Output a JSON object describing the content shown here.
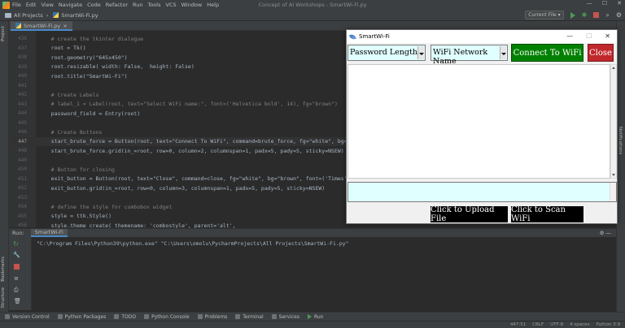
{
  "menubar": {
    "items": [
      "File",
      "Edit",
      "View",
      "Navigate",
      "Code",
      "Refactor",
      "Run",
      "Tools",
      "VCS",
      "Window",
      "Help"
    ],
    "window_title": "Concept of AI Workshops - SmartWi-Fi.py"
  },
  "navbar": {
    "breadcrumb_project": "All Projects",
    "breadcrumb_file": "SmartWi-Fi.py",
    "run_config": "Current File ▾"
  },
  "editor": {
    "tab_label": "SmartWi-Fi.py",
    "lines": [
      {
        "n": "436",
        "code": "    # create the tkinter dialogue"
      },
      {
        "n": "437",
        "code": "    root = Tk()"
      },
      {
        "n": "438",
        "code": "    root.geometry(\"645x450\")"
      },
      {
        "n": "439",
        "code": "    root.resizable( width: False,  height: False)"
      },
      {
        "n": "440",
        "code": "    root.title(\"SmartWi-Fi\")"
      },
      {
        "n": "441",
        "code": ""
      },
      {
        "n": "442",
        "code": "    # Create Labels"
      },
      {
        "n": "443",
        "code": "    # label_1 = Label(root, text=\"Select WiFi name:\", font=('Helvetica bold', 14), fg=\"brown\")"
      },
      {
        "n": "444",
        "code": "    password_field = Entry(root)"
      },
      {
        "n": "445",
        "code": ""
      },
      {
        "n": "446",
        "code": "    # Create Buttons"
      },
      {
        "n": "447",
        "code": "    start_brute_force = Button(root, text=\"Connect To WiFi\", command=brute_force, fg=\"white\", bg=\""
      },
      {
        "n": "448",
        "code": "    start_brute_force.grid(in_=root, row=0, column=2, columnspan=1, padx=5, pady=5, sticky=NSEW)"
      },
      {
        "n": "449",
        "code": ""
      },
      {
        "n": "450",
        "code": "    # Button for closing"
      },
      {
        "n": "451",
        "code": "    exit_button = Button(root, text=\"Close\", command=close, fg=\"white\", bg=\"brown\", font=('Times',"
      },
      {
        "n": "452",
        "code": "    exit_button.grid(in_=root, row=0, column=3, columnspan=1, padx=5, pady=5, sticky=NSEW)"
      },
      {
        "n": "453",
        "code": ""
      },
      {
        "n": "454",
        "code": "    # define the style for combobox widget"
      },
      {
        "n": "455",
        "code": "    style = ttk.Style()"
      },
      {
        "n": "456",
        "code": "    style.theme_create( themename: 'combostyle', parent='alt',"
      }
    ],
    "current_line": "447"
  },
  "bottom_panel": {
    "run_label": "Run:",
    "run_tab": "SmartWi-Fi",
    "console_output": "\"C:\\Program Files\\Python39\\python.exe\" \"C:\\Users\\omolu\\PycharmProjects\\All Projects\\SmartWi-Fi.py\""
  },
  "tool_windows": [
    "Version Control",
    "Python Packages",
    "TODO",
    "Python Console",
    "Problems",
    "Terminal",
    "Services",
    "Run"
  ],
  "statusbar": {
    "position": "447:51",
    "line_sep": "CRLF",
    "encoding": "UTF-8",
    "indent": "4 spaces",
    "interpreter": "Python 3.9"
  },
  "side_labels": {
    "project": "Project",
    "bookmarks": "Bookmarks",
    "structure": "Structure",
    "notifications": "Notifications"
  },
  "tk_window": {
    "title": "SmartWi-Fi",
    "password_combo": "Password Length",
    "wifi_combo": "WiFi Network Name",
    "connect_button": "Connect To WiFi",
    "close_button": "Close",
    "upload_button": "Click to Upload File",
    "scan_button": "Click to Scan WiFi",
    "colors": {
      "connect_bg": "#008000",
      "close_bg": "#c0282d",
      "dark_button_bg": "#000000",
      "field_bg": "#e0ffff"
    }
  }
}
